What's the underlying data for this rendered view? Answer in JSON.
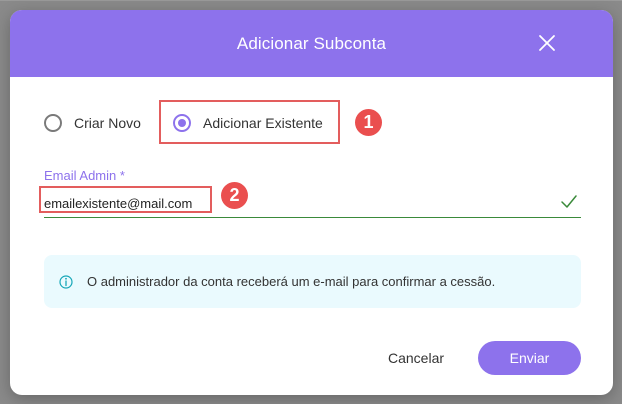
{
  "modal": {
    "title": "Adicionar Subconta",
    "close_icon": "close-icon"
  },
  "radios": [
    {
      "label": "Criar Novo",
      "selected": false
    },
    {
      "label": "Adicionar Existente",
      "selected": true
    }
  ],
  "email": {
    "label": "Email Admin *",
    "value": "emailexistente@mail.com",
    "valid": true
  },
  "info": {
    "icon": "info-icon",
    "text": "O administrador da conta receberá um e-mail para confirmar a cessão."
  },
  "buttons": {
    "cancel": "Cancelar",
    "submit": "Enviar"
  },
  "annotations": {
    "step1": "1",
    "step2": "2"
  },
  "colors": {
    "accent": "#8d72ec",
    "highlight": "#e35d5d",
    "badge": "#ea4f4f",
    "valid": "#3a8a3a",
    "info_bg": "#eafafe"
  }
}
